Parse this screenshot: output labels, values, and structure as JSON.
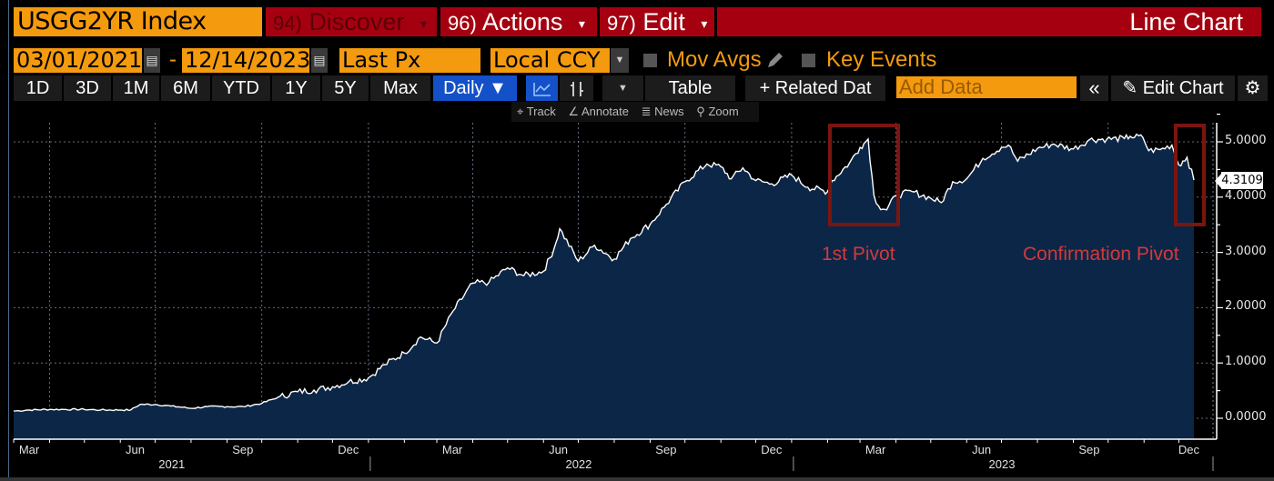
{
  "header": {
    "ticker": "USGG2YR Index",
    "discover": {
      "num": "94)",
      "label": "Discover"
    },
    "actions": {
      "num": "96)",
      "label": "Actions"
    },
    "edit": {
      "num": "97)",
      "label": "Edit"
    },
    "title": "Line Chart"
  },
  "controls": {
    "start_date": "03/01/2021",
    "end_date": "12/14/2023",
    "separator": "-",
    "field": "Last Px",
    "currency": "Local CCY",
    "mov_avgs": "Mov Avgs",
    "key_events": "Key Events"
  },
  "toolbar": {
    "ranges": [
      "1D",
      "3D",
      "1M",
      "6M",
      "YTD",
      "1Y",
      "5Y",
      "Max"
    ],
    "periodicity": "Daily ▼",
    "table": "Table",
    "related": "+ Related Dat",
    "add_data_placeholder": "Add Data",
    "collapse": "«",
    "edit_chart": "Edit Chart"
  },
  "subtoolbar": {
    "track": "Track",
    "annotate": "Annotate",
    "news": "News",
    "zoom": "Zoom"
  },
  "colors": {
    "brand_orange": "#f39a0e",
    "header_red": "#a50010",
    "area_fill": "#0c2648",
    "line": "#ffffff",
    "annotation": "#d23a3a",
    "annotation_box": "#7a1510"
  },
  "chart_data": {
    "type": "area",
    "title": "USGG2YR Index",
    "xlabel": "",
    "ylabel": "",
    "ylim": [
      -0.2,
      5.5
    ],
    "yticks": [
      "0.0000",
      "1.0000",
      "2.0000",
      "3.0000",
      "4.0000",
      "5.0000"
    ],
    "ytick_values": [
      0,
      1,
      2,
      3,
      4,
      5
    ],
    "last_value": "4.3109",
    "x_start": "2021-03-01",
    "x_end": "2023-12-14",
    "month_labels": [
      {
        "label": "Mar",
        "date": "2021-03-15"
      },
      {
        "label": "Jun",
        "date": "2021-06-15"
      },
      {
        "label": "Sep",
        "date": "2021-09-15"
      },
      {
        "label": "Dec",
        "date": "2021-12-15"
      },
      {
        "label": "Mar",
        "date": "2022-03-15"
      },
      {
        "label": "Jun",
        "date": "2022-06-15"
      },
      {
        "label": "Sep",
        "date": "2022-09-15"
      },
      {
        "label": "Dec",
        "date": "2022-12-15"
      },
      {
        "label": "Mar",
        "date": "2023-03-15"
      },
      {
        "label": "Jun",
        "date": "2023-06-15"
      },
      {
        "label": "Sep",
        "date": "2023-09-15"
      },
      {
        "label": "Dec",
        "date": "2023-12-10"
      }
    ],
    "year_labels": [
      {
        "label": "2021",
        "date": "2021-07-15"
      },
      {
        "label": "2022",
        "date": "2022-07-01"
      },
      {
        "label": "2023",
        "date": "2023-07-01"
      }
    ],
    "grid": true,
    "annotations": [
      {
        "label": "1st Pivot",
        "from": "2023-02-01",
        "to": "2023-03-20",
        "ylow": 3.4,
        "yhigh": 5.3
      },
      {
        "label": "Confirmation Pivot",
        "from": "2023-10-20",
        "to": "2023-11-15",
        "ylow": 3.4,
        "yhigh": 5.3
      }
    ],
    "series": [
      {
        "name": "USGG2YR Index",
        "points": [
          [
            "2021-03-01",
            0.13
          ],
          [
            "2021-03-15",
            0.15
          ],
          [
            "2021-04-01",
            0.16
          ],
          [
            "2021-04-15",
            0.16
          ],
          [
            "2021-05-01",
            0.16
          ],
          [
            "2021-05-15",
            0.15
          ],
          [
            "2021-06-01",
            0.15
          ],
          [
            "2021-06-10",
            0.15
          ],
          [
            "2021-06-18",
            0.25
          ],
          [
            "2021-07-01",
            0.25
          ],
          [
            "2021-07-15",
            0.22
          ],
          [
            "2021-08-01",
            0.18
          ],
          [
            "2021-08-15",
            0.21
          ],
          [
            "2021-09-01",
            0.21
          ],
          [
            "2021-09-15",
            0.21
          ],
          [
            "2021-10-01",
            0.27
          ],
          [
            "2021-10-15",
            0.38
          ],
          [
            "2021-11-01",
            0.48
          ],
          [
            "2021-11-15",
            0.51
          ],
          [
            "2021-12-01",
            0.57
          ],
          [
            "2021-12-15",
            0.66
          ],
          [
            "2022-01-01",
            0.73
          ],
          [
            "2022-01-15",
            0.97
          ],
          [
            "2022-02-01",
            1.18
          ],
          [
            "2022-02-15",
            1.47
          ],
          [
            "2022-03-01",
            1.36
          ],
          [
            "2022-03-15",
            1.94
          ],
          [
            "2022-04-01",
            2.44
          ],
          [
            "2022-04-15",
            2.46
          ],
          [
            "2022-05-01",
            2.72
          ],
          [
            "2022-05-15",
            2.58
          ],
          [
            "2022-06-01",
            2.66
          ],
          [
            "2022-06-10",
            3.06
          ],
          [
            "2022-06-15",
            3.43
          ],
          [
            "2022-07-01",
            2.84
          ],
          [
            "2022-07-15",
            3.13
          ],
          [
            "2022-08-01",
            2.88
          ],
          [
            "2022-08-15",
            3.25
          ],
          [
            "2022-09-01",
            3.51
          ],
          [
            "2022-09-15",
            3.87
          ],
          [
            "2022-10-01",
            4.28
          ],
          [
            "2022-10-20",
            4.6
          ],
          [
            "2022-11-01",
            4.55
          ],
          [
            "2022-11-10",
            4.33
          ],
          [
            "2022-11-20",
            4.53
          ],
          [
            "2022-12-01",
            4.3
          ],
          [
            "2022-12-15",
            4.24
          ],
          [
            "2023-01-01",
            4.4
          ],
          [
            "2023-01-15",
            4.18
          ],
          [
            "2023-02-01",
            4.1
          ],
          [
            "2023-02-05",
            4.3
          ],
          [
            "2023-02-20",
            4.62
          ],
          [
            "2023-03-01",
            4.9
          ],
          [
            "2023-03-08",
            5.05
          ],
          [
            "2023-03-13",
            4.03
          ],
          [
            "2023-03-17",
            3.84
          ],
          [
            "2023-03-24",
            3.77
          ],
          [
            "2023-04-01",
            4.03
          ],
          [
            "2023-04-15",
            4.1
          ],
          [
            "2023-05-01",
            3.98
          ],
          [
            "2023-05-10",
            3.9
          ],
          [
            "2023-05-20",
            4.28
          ],
          [
            "2023-06-01",
            4.33
          ],
          [
            "2023-06-15",
            4.7
          ],
          [
            "2023-07-01",
            4.9
          ],
          [
            "2023-07-07",
            4.94
          ],
          [
            "2023-07-15",
            4.65
          ],
          [
            "2023-08-01",
            4.88
          ],
          [
            "2023-08-15",
            4.96
          ],
          [
            "2023-09-01",
            4.87
          ],
          [
            "2023-09-15",
            5.04
          ],
          [
            "2023-09-30",
            5.05
          ],
          [
            "2023-10-15",
            5.06
          ],
          [
            "2023-10-20",
            5.1
          ],
          [
            "2023-10-31",
            5.08
          ],
          [
            "2023-11-05",
            4.84
          ],
          [
            "2023-11-15",
            4.86
          ],
          [
            "2023-11-25",
            4.94
          ],
          [
            "2023-12-01",
            4.58
          ],
          [
            "2023-12-08",
            4.72
          ],
          [
            "2023-12-14",
            4.31
          ]
        ]
      }
    ]
  }
}
